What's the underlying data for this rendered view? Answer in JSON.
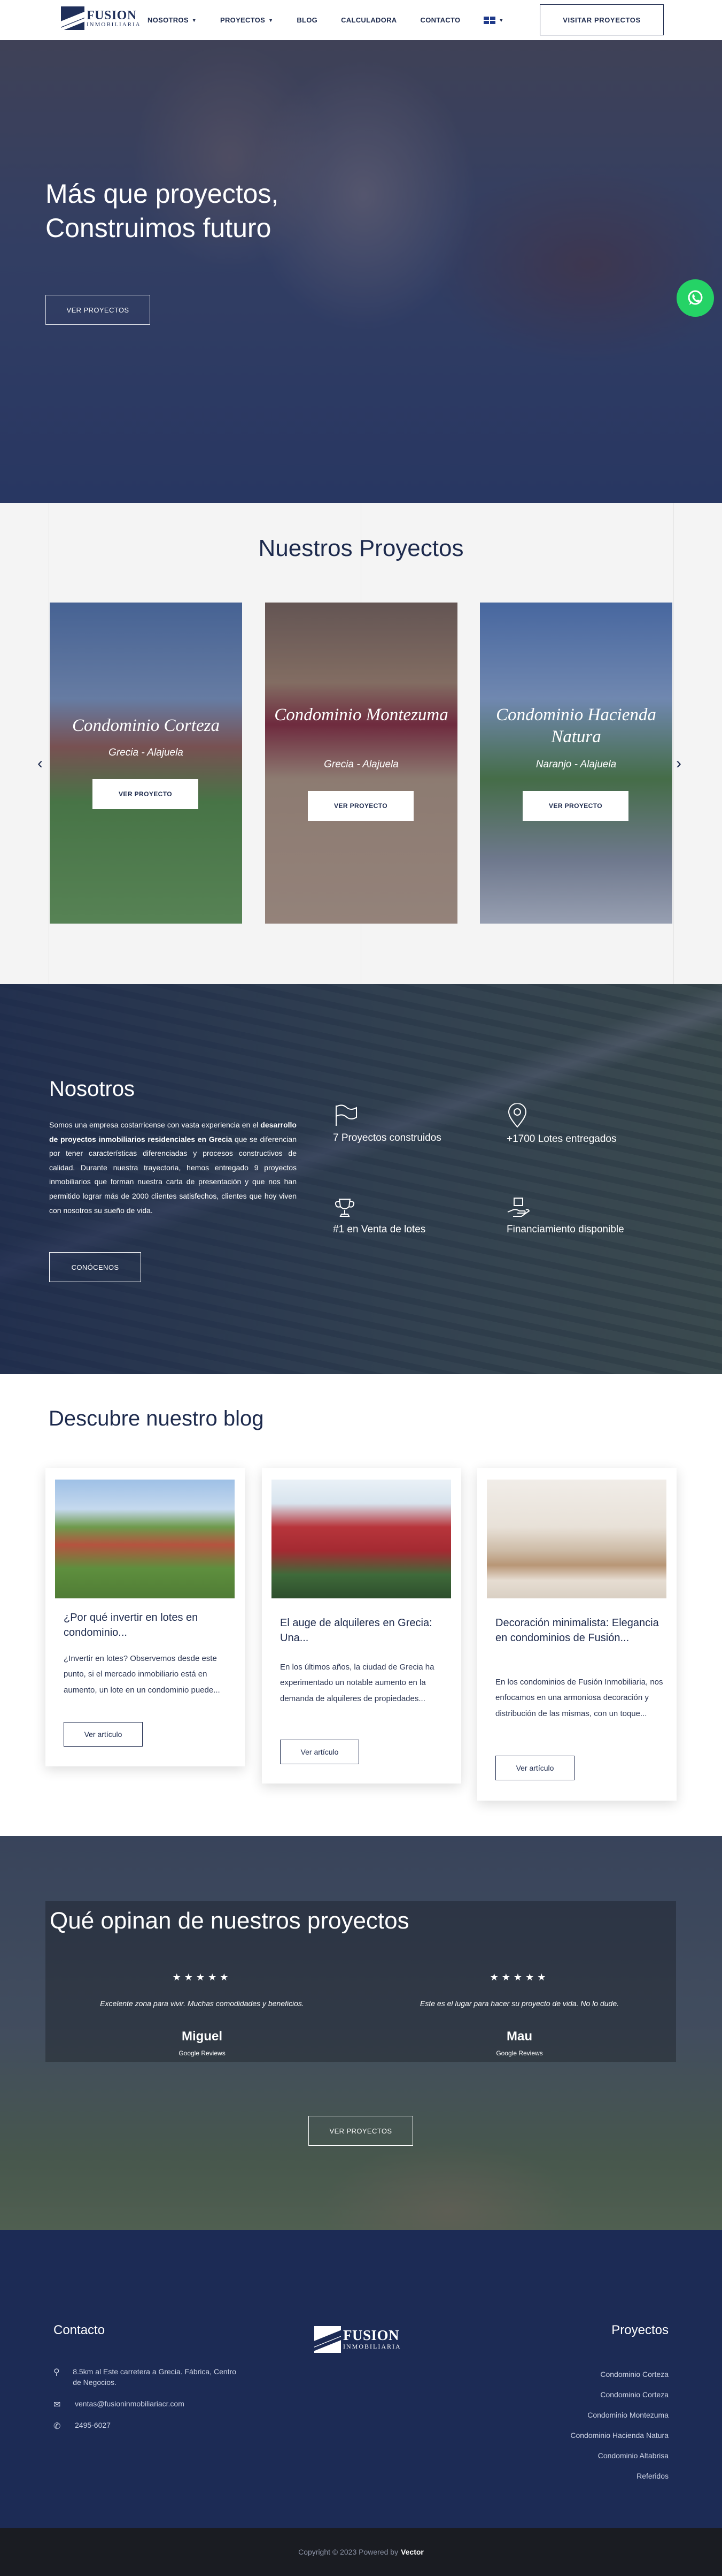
{
  "nav": {
    "logo_line1": "FUSION",
    "logo_line2": "INMOBILIARIA",
    "items": [
      {
        "label": "NOSOTROS",
        "has_dropdown": true
      },
      {
        "label": "PROYECTOS",
        "has_dropdown": true
      },
      {
        "label": "BLOG",
        "has_dropdown": false
      },
      {
        "label": "CALCULADORA",
        "has_dropdown": false
      },
      {
        "label": "CONTACTO",
        "has_dropdown": false
      }
    ],
    "language_icon": "uk-flag-icon",
    "cta": "VISITAR PROYECTOS"
  },
  "hero": {
    "title_line1": "Más que proyectos,",
    "title_line2": "Construimos futuro",
    "button": "VER PROYECTOS"
  },
  "projects": {
    "title": "Nuestros Proyectos",
    "cards": [
      {
        "title": "Condominio Corteza",
        "location": "Grecia - Alajuela",
        "button": "VER PROYECTO"
      },
      {
        "title": "Condominio Montezuma",
        "location": "Grecia - Alajuela",
        "button": "VER PROYECTO"
      },
      {
        "title": "Condominio Hacienda Natura",
        "location": "Naranjo - Alajuela",
        "button": "VER PROYECTO"
      }
    ]
  },
  "about": {
    "title": "Nosotros",
    "text_1": "Somos una empresa costarricense con vasta experiencia en el ",
    "text_bold": "desarrollo de proyectos inmobiliarios residenciales en Grecia",
    "text_2": " que se diferencian por tener características diferenciadas y procesos constructivos de calidad. Durante nuestra trayectoria, hemos entregado 9 proyectos inmobiliarios que forman nuestra carta de presentación y que nos han permitido lograr más de 2000 clientes satisfechos, clientes que hoy viven con nosotros su sueño de vida.",
    "button": "CONÓCENOS",
    "stats": [
      {
        "label": "7 Proyectos construidos",
        "icon": "flag-icon"
      },
      {
        "label": "+1700 Lotes entregados",
        "icon": "location-pin-icon"
      },
      {
        "label": "#1 en Venta de lotes",
        "icon": "trophy-icon"
      },
      {
        "label": "Financiamiento disponible",
        "icon": "hand-money-icon"
      }
    ]
  },
  "blog": {
    "title": "Descubre nuestro blog",
    "posts": [
      {
        "title": "¿Por qué invertir en lotes en condominio...",
        "excerpt": "¿Invertir en lotes? Observemos desde este punto, si el mercado inmobiliario está en aumento, un lote en un condominio puede...",
        "button": "Ver artículo"
      },
      {
        "title": "El auge de alquileres en Grecia: Una...",
        "excerpt": "En los últimos años, la ciudad de Grecia ha experimentado un notable aumento en la demanda de alquileres de propiedades...",
        "button": "Ver artículo"
      },
      {
        "title": "Decoración minimalista: Elegancia en condominios de Fusión...",
        "excerpt": "En los condominios de Fusión Inmobiliaria, nos enfocamos en una armoniosa decoración y distribución de las mismas, con un toque...",
        "button": "Ver artículo"
      }
    ]
  },
  "reviews": {
    "title": "Qué opinan de nuestros proyectos",
    "items": [
      {
        "stars": "★★★★★",
        "quote": "Excelente zona para vivir. Muchas comodidades y beneficios.",
        "name": "Miguel",
        "source": "Google Reviews"
      },
      {
        "stars": "★★★★★",
        "quote": "Este es el lugar para hacer su proyecto de vida. No lo dude.",
        "name": "Mau",
        "source": "Google Reviews"
      }
    ],
    "button": "VER PROYECTOS"
  },
  "footer": {
    "contact_title": "Contacto",
    "address": "8.5km al Este carretera a Grecia. Fábrica, Centro de Negocios.",
    "email": "ventas@fusioninmobiliariacr.com",
    "phone": "2495-6027",
    "logo_line1": "FUSION",
    "logo_line2": "INMOBILIARIA",
    "projects_title": "Proyectos",
    "projects": [
      "Condominio Corteza",
      "Condominio Corteza",
      "Condominio Montezuma",
      "Condominio Hacienda Natura",
      "Condominio Altabrisa",
      "Referidos"
    ],
    "copyright": "Copyright © 2023 Powered by",
    "brand": "Vector"
  },
  "colors": {
    "brand_navy": "#1d2a4d",
    "footer_bg": "#1c2b55",
    "whatsapp": "#25d366"
  }
}
